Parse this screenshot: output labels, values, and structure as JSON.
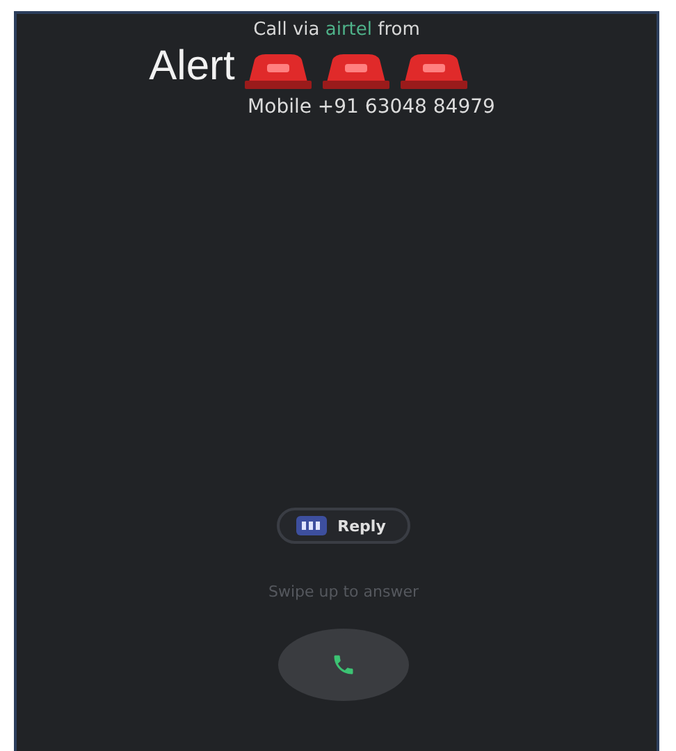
{
  "call_header": {
    "prefix": "Call via",
    "carrier": "airtel",
    "suffix": "from"
  },
  "caller": {
    "name": "Alert",
    "number": "Mobile +91 63048 84979"
  },
  "reply_button": {
    "label": "Reply"
  },
  "hint": "Swipe up to answer"
}
